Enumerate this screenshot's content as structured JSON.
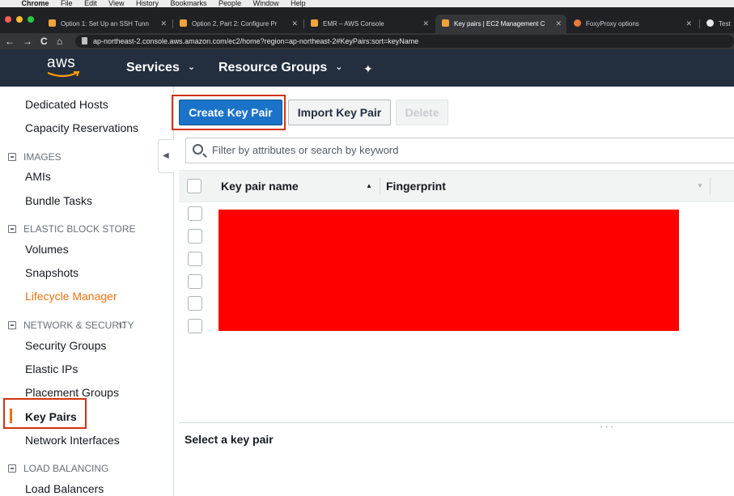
{
  "os_menubar": {
    "apple_glyph": "",
    "app_name": "Chrome",
    "items": [
      "File",
      "Edit",
      "View",
      "History",
      "Bookmarks",
      "People",
      "Window",
      "Help"
    ]
  },
  "browser": {
    "tabs": [
      {
        "title": "Option 1: Set Up an SSH Tunn"
      },
      {
        "title": "Option 2, Part 2: Configure Pr"
      },
      {
        "title": "EMR – AWS Console"
      },
      {
        "title": "Key pairs | EC2 Management C",
        "active": true
      },
      {
        "title": "FoxyProxy options"
      },
      {
        "title": "Test"
      }
    ],
    "url": "ap-northeast-2.console.aws.amazon.com/ec2/home?region=ap-northeast-2#KeyPairs:sort=keyName",
    "nav": {
      "back": "←",
      "forward": "→",
      "reload": "C",
      "home": "⌂"
    }
  },
  "aws_header": {
    "logo": "aws",
    "services_label": "Services",
    "resource_groups_label": "Resource Groups",
    "chevron": "⌄",
    "pin_glyph": "✦"
  },
  "sidebar": {
    "items_top": [
      "Dedicated Hosts",
      "Capacity Reservations"
    ],
    "images_section": "IMAGES",
    "images_items": [
      "AMIs",
      "Bundle Tasks"
    ],
    "ebs_section": "ELASTIC BLOCK STORE",
    "ebs_items": [
      "Volumes",
      "Snapshots",
      "Lifecycle Manager"
    ],
    "network_section": "NETWORK & SECURITY",
    "network_items": [
      "Security Groups",
      "Elastic IPs",
      "Placement Groups",
      "Key Pairs",
      "Network Interfaces"
    ],
    "lb_section": "LOAD BALANCING",
    "lb_items": [
      "Load Balancers"
    ],
    "collapse_glyph": "◀"
  },
  "toolbar": {
    "create_label": "Create Key Pair",
    "import_label": "Import Key Pair",
    "delete_label": "Delete"
  },
  "filter": {
    "placeholder": "Filter by attributes or search by keyword"
  },
  "table": {
    "columns": [
      "Key pair name",
      "Fingerprint"
    ],
    "sort_asc": "▲",
    "sort_desc": "▼",
    "row_count": 6
  },
  "detail_pane": {
    "title": "Select a key pair",
    "grip": "• • •"
  },
  "colors": {
    "aws_header": "#232f3e",
    "accent_orange": "#ec7211",
    "primary_button": "#1a73c8",
    "highlight_box": "#d13212",
    "redaction": "#ff0000"
  }
}
